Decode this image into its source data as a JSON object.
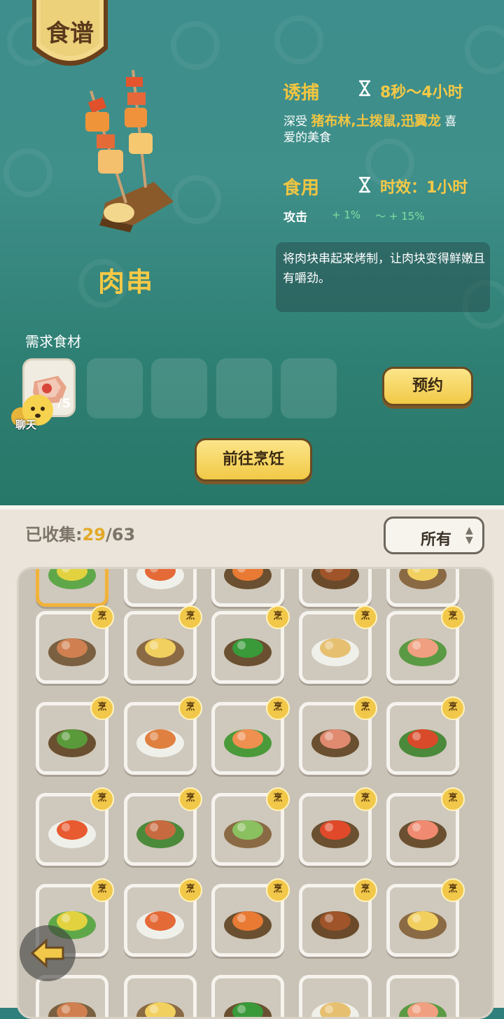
{
  "recipe_banner": "食谱",
  "dish": {
    "name": "肉串"
  },
  "lure": {
    "label": "诱捕",
    "time": "8秒～4小时",
    "desc_prefix": "深受",
    "creatures": "猪布林,土拨鼠,迅翼龙",
    "desc_suffix": "喜",
    "desc_line2": "爱的美食"
  },
  "eat": {
    "label": "食用",
    "time": "时效：1小时",
    "stat_label": "攻击",
    "stat_min": "+ 1%",
    "stat_max": "～ + 15%"
  },
  "description": "将肉块串起来烤制，让肉块变得鲜嫩且有嚼劲。",
  "ingredients": {
    "title": "需求食材",
    "count": "/5"
  },
  "chat_label": "聊天",
  "buttons": {
    "reserve": "预约",
    "cook": "前往烹饪"
  },
  "collection": {
    "label": "已收集:",
    "collected": "29",
    "total": "/63"
  },
  "filter": {
    "selected": "所有"
  },
  "badge_text": "烹",
  "colors": {
    "accent": "#f6c946",
    "teal_bg": "#3d8e8c",
    "panel": "#eae4da",
    "badge": "#f2c84a"
  }
}
